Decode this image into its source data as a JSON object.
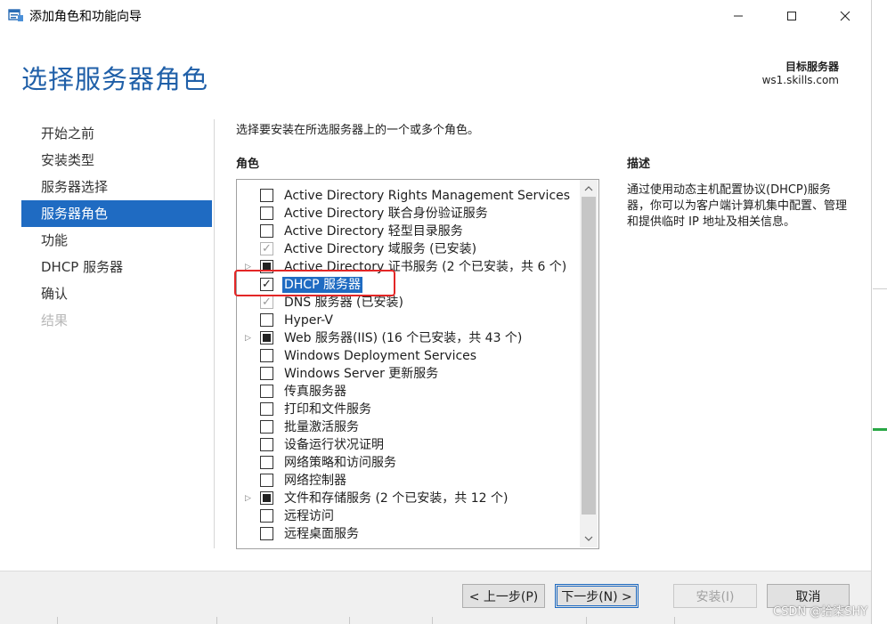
{
  "window": {
    "title": "添加角色和功能向导"
  },
  "header": {
    "page_title": "选择服务器角色",
    "target_label": "目标服务器",
    "target_server": "ws1.skills.com"
  },
  "nav": {
    "items": [
      {
        "label": "开始之前",
        "state": "normal"
      },
      {
        "label": "安装类型",
        "state": "normal"
      },
      {
        "label": "服务器选择",
        "state": "normal"
      },
      {
        "label": "服务器角色",
        "state": "active"
      },
      {
        "label": "功能",
        "state": "normal"
      },
      {
        "label": "DHCP 服务器",
        "state": "normal"
      },
      {
        "label": "确认",
        "state": "normal"
      },
      {
        "label": "结果",
        "state": "disabled"
      }
    ]
  },
  "main": {
    "instruction": "选择要安装在所选服务器上的一个或多个角色。",
    "roles_header": "角色",
    "roles": [
      {
        "label": "Active Directory Rights Management Services",
        "check": "none",
        "expander": false
      },
      {
        "label": "Active Directory 联合身份验证服务",
        "check": "none",
        "expander": false
      },
      {
        "label": "Active Directory 轻型目录服务",
        "check": "none",
        "expander": false
      },
      {
        "label": "Active Directory 域服务 (已安装)",
        "check": "checked-disabled",
        "expander": false
      },
      {
        "label": "Active Directory 证书服务 (2 个已安装，共 6 个)",
        "check": "partial",
        "expander": true
      },
      {
        "label": "DHCP 服务器",
        "check": "checked",
        "expander": false,
        "selected": true
      },
      {
        "label": "DNS 服务器 (已安装)",
        "check": "checked-disabled",
        "expander": false
      },
      {
        "label": "Hyper-V",
        "check": "none",
        "expander": false
      },
      {
        "label": "Web 服务器(IIS) (16 个已安装，共 43 个)",
        "check": "partial",
        "expander": true
      },
      {
        "label": "Windows Deployment Services",
        "check": "none",
        "expander": false
      },
      {
        "label": "Windows Server 更新服务",
        "check": "none",
        "expander": false
      },
      {
        "label": "传真服务器",
        "check": "none",
        "expander": false
      },
      {
        "label": "打印和文件服务",
        "check": "none",
        "expander": false
      },
      {
        "label": "批量激活服务",
        "check": "none",
        "expander": false
      },
      {
        "label": "设备运行状况证明",
        "check": "none",
        "expander": false
      },
      {
        "label": "网络策略和访问服务",
        "check": "none",
        "expander": false
      },
      {
        "label": "网络控制器",
        "check": "none",
        "expander": false
      },
      {
        "label": "文件和存储服务 (2 个已安装，共 12 个)",
        "check": "partial",
        "expander": true
      },
      {
        "label": "远程访问",
        "check": "none",
        "expander": false
      },
      {
        "label": "远程桌面服务",
        "check": "none",
        "expander": false
      }
    ],
    "description_header": "描述",
    "description_text": "通过使用动态主机配置协议(DHCP)服务器，你可以为客户端计算机集中配置、管理和提供临时 IP 地址及相关信息。"
  },
  "buttons": {
    "prev": "< 上一步(P)",
    "next": "下一步(N) >",
    "install": "安装(I)",
    "cancel": "取消"
  },
  "watermark": "CSDN @拾柒SHY",
  "colors": {
    "accent": "#1f6bc2",
    "title_blue": "#1f5fa8",
    "highlight_red": "#e32626"
  }
}
